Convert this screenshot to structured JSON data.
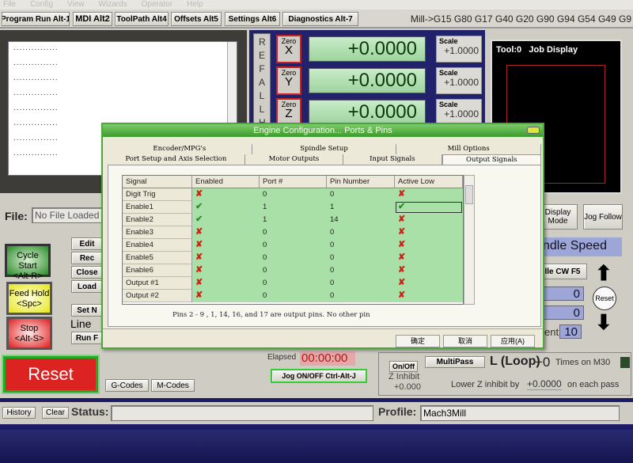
{
  "menu": [
    "File",
    "Config",
    "View",
    "Wizards",
    "Operator",
    "Help"
  ],
  "tabs": [
    "Program Run Alt-1",
    "MDI Alt2",
    "ToolPath Alt4",
    "Offsets Alt5",
    "Settings Alt6",
    "Diagnostics Alt-7"
  ],
  "gcode_status": "Mill->G15  G80 G17 G40 G20 G90 G94 G54 G49 G9",
  "code_lines": [
    "...............",
    "...............",
    "...............",
    "...............",
    "...............",
    "...............",
    "...............",
    "..............."
  ],
  "dro": {
    "ref_all_home": "REFALLH",
    "axes": [
      {
        "zero": "Zero",
        "axis": "X",
        "value": "+0.0000",
        "scale_label": "Scale",
        "scale": "+1.0000"
      },
      {
        "zero": "Zero",
        "axis": "Y",
        "value": "+0.0000",
        "scale_label": "Scale",
        "scale": "+1.0000"
      },
      {
        "zero": "Zero",
        "axis": "Z",
        "value": "+0.0000",
        "scale_label": "Scale",
        "scale": "+1.0000"
      }
    ]
  },
  "job_display": {
    "tool": "Tool:0",
    "title": "Job Display"
  },
  "file": {
    "label": "File:",
    "value": "No File Loaded"
  },
  "buttons": {
    "cycle_start": "Cycle Start",
    "cycle_start_key": "<Alt-R>",
    "feed_hold": "Feed Hold",
    "feed_hold_key": "<Spc>",
    "stop": "Stop",
    "stop_key": "<Alt-S>",
    "edit": "Edit",
    "recent": "Rec",
    "close": "Close",
    "load": "Load",
    "set_next": "Set N",
    "run_from": "Run F",
    "line": "Line",
    "reset": "Reset",
    "gcodes": "G-Codes",
    "mcodes": "M-Codes",
    "display_mode": "Display Mode",
    "jog_follow": "Jog Follow",
    "history": "History",
    "clear": "Clear"
  },
  "spindle": {
    "title": "ndle Speed",
    "cw": "lle CW F5",
    "val1": "0",
    "val2": "0",
    "increment_label": "ent",
    "increment": "10",
    "reset": "Reset"
  },
  "elapsed": {
    "label": "Elapsed",
    "value": "00:00:00",
    "jog": "Jog ON/OFF Ctrl-Alt-J"
  },
  "multipass": {
    "onoff": "On/Off",
    "zinhibit": "Z Inhibit",
    "zinhibit_value": "+0.000",
    "multipass": "MultiPass",
    "loop": "L (Loop)",
    "loop_value": "+0",
    "times": "Times on M30",
    "lower": "Lower Z inhibit by",
    "lower_value": "+0.0000",
    "each": "on each pass"
  },
  "status": {
    "label": "Status:",
    "value": "",
    "profile_label": "Profile:",
    "profile": "Mach3Mill"
  },
  "dialog": {
    "title": "Engine Configuration... Ports & Pins",
    "tabs_row1": [
      "Encoder/MPG's",
      "Spindle Setup",
      "Mill Options"
    ],
    "tabs_row2": [
      "Port Setup and Axis Selection",
      "Motor Outputs",
      "Input Signals",
      "Output Signals"
    ],
    "active_tab": "Output Signals",
    "columns": [
      "Signal",
      "Enabled",
      "Port #",
      "Pin Number",
      "Active Low"
    ],
    "rows": [
      {
        "signal": "Digit Trig",
        "enabled": false,
        "port": "0",
        "pin": "0",
        "active_low": false
      },
      {
        "signal": "Enable1",
        "enabled": true,
        "port": "1",
        "pin": "1",
        "active_low": true
      },
      {
        "signal": "Enable2",
        "enabled": true,
        "port": "1",
        "pin": "14",
        "active_low": false
      },
      {
        "signal": "Enable3",
        "enabled": false,
        "port": "0",
        "pin": "0",
        "active_low": false
      },
      {
        "signal": "Enable4",
        "enabled": false,
        "port": "0",
        "pin": "0",
        "active_low": false
      },
      {
        "signal": "Enable5",
        "enabled": false,
        "port": "0",
        "pin": "0",
        "active_low": false
      },
      {
        "signal": "Enable6",
        "enabled": false,
        "port": "0",
        "pin": "0",
        "active_low": false
      },
      {
        "signal": "Output #1",
        "enabled": false,
        "port": "0",
        "pin": "0",
        "active_low": false
      },
      {
        "signal": "Output #2",
        "enabled": false,
        "port": "0",
        "pin": "0",
        "active_low": false
      }
    ],
    "note": "Pins 2 - 9 , 1, 14, 16, and 17 are output pins. No  other pin",
    "ok": "确定",
    "cancel": "取消",
    "apply": "应用(A)"
  }
}
